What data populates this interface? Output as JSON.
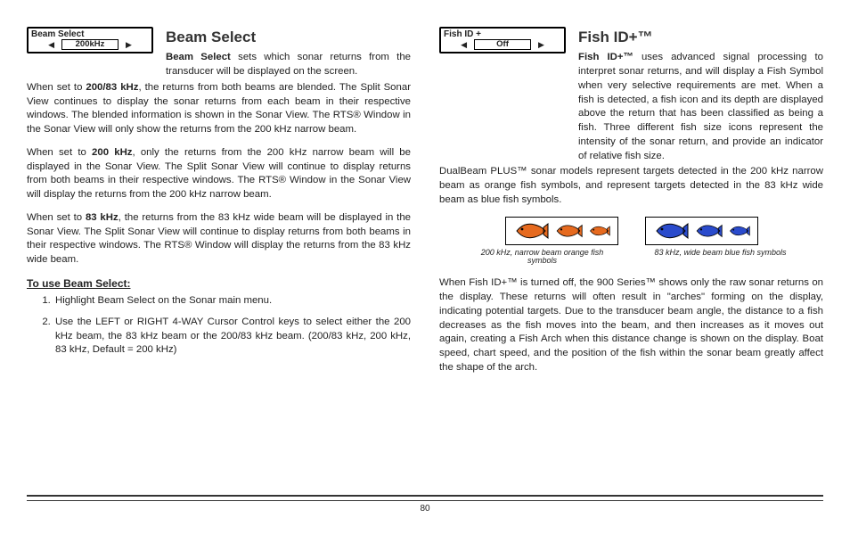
{
  "page_number": "80",
  "left": {
    "widget": {
      "label": "Beam Select",
      "value": "200kHz"
    },
    "title": "Beam Select",
    "intro_lead": "Beam Select",
    "intro_rest": " sets which sonar returns from the transducer will be displayed on the screen.",
    "p1_lead": "When set to ",
    "p1_bold": "200/83 kHz",
    "p1_rest": ", the returns from both beams are blended. The Split Sonar View continues to display the sonar returns from each beam in their respective windows. The blended information is shown in the Sonar View. The RTS® Window in the Sonar View will only show the returns from the 200 kHz narrow beam.",
    "p2_lead": "When set to ",
    "p2_bold": "200 kHz",
    "p2_rest": ", only the returns from the 200 kHz narrow beam will be displayed in the Sonar View. The Split Sonar View will continue to display returns from both beams in their respective windows. The RTS® Window in the Sonar View will display the returns from the 200 kHz narrow beam.",
    "p3_lead": "When set to ",
    "p3_bold": "83 kHz",
    "p3_rest": ", the returns from the 83 kHz wide beam will be displayed in the Sonar View. The Split Sonar View will continue to display returns from both beams in their respective windows. The RTS® Window will display the returns from the 83 kHz wide beam.",
    "instr_head": "To use Beam Select:",
    "steps": [
      "Highlight Beam Select on the Sonar main menu.",
      "Use the LEFT or RIGHT 4-WAY Cursor Control keys to select either the 200 kHz beam, the 83 kHz beam or the 200/83 kHz beam. (200/83 kHz, 200 kHz, 83 kHz, Default = 200 kHz)"
    ]
  },
  "right": {
    "widget": {
      "label": "Fish ID +",
      "value": "Off"
    },
    "title": "Fish ID+™",
    "intro_lead": "Fish ID+™",
    "intro_rest": " uses advanced signal processing to interpret sonar returns, and will display a Fish Symbol when very selective requirements are met. When a fish is detected, a fish icon and its depth are displayed above the return that has been classified as being a fish. Three different fish size icons represent the intensity of the sonar return, and provide an indicator of relative fish size.",
    "p2": "DualBeam PLUS™ sonar models represent targets detected in the 200 kHz narrow beam as orange fish symbols, and represent targets detected in the 83 kHz wide beam as blue fish symbols.",
    "caption1": "200 kHz, narrow beam orange fish symbols",
    "caption2": "83 kHz, wide beam blue fish symbols",
    "p3": "When Fish ID+™ is turned off, the 900 Series™ shows only the raw sonar returns on the display. These returns will often result in \"arches\" forming on the display, indicating potential targets. Due to the transducer beam angle, the distance to a fish decreases as the fish moves into the beam, and then increases as it moves out again, creating a Fish Arch when this distance change is shown on the display. Boat speed, chart speed, and the position of the fish within the sonar beam greatly affect the shape of the arch."
  }
}
